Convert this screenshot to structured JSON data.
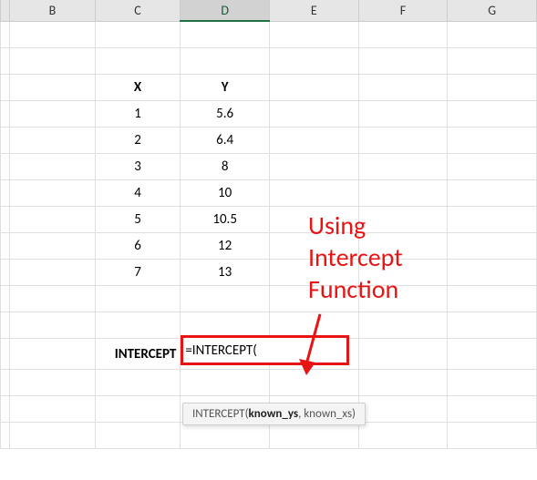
{
  "columns": {
    "b": "B",
    "c": "C",
    "d": "D",
    "e": "E",
    "f": "F",
    "g": "G"
  },
  "headers": {
    "x": "X",
    "y": "Y"
  },
  "rows": [
    {
      "x": "1",
      "y": "5.6"
    },
    {
      "x": "2",
      "y": "6.4"
    },
    {
      "x": "3",
      "y": "8"
    },
    {
      "x": "4",
      "y": "10"
    },
    {
      "x": "5",
      "y": "10.5"
    },
    {
      "x": "6",
      "y": "12"
    },
    {
      "x": "7",
      "y": "13"
    }
  ],
  "label": "INTERCEPT",
  "formula": "=INTERCEPT(",
  "tooltip": {
    "fn": "INTERCEPT(",
    "arg1": "known_ys",
    "rest": ", known_xs)"
  },
  "annotation": {
    "l1": "Using",
    "l2": "Intercept",
    "l3": "Function"
  },
  "chart_data": {
    "type": "table",
    "title": "",
    "columns": [
      "X",
      "Y"
    ],
    "rows": [
      [
        1,
        5.6
      ],
      [
        2,
        6.4
      ],
      [
        3,
        8
      ],
      [
        4,
        10
      ],
      [
        5,
        10.5
      ],
      [
        6,
        12
      ],
      [
        7,
        13
      ]
    ]
  }
}
